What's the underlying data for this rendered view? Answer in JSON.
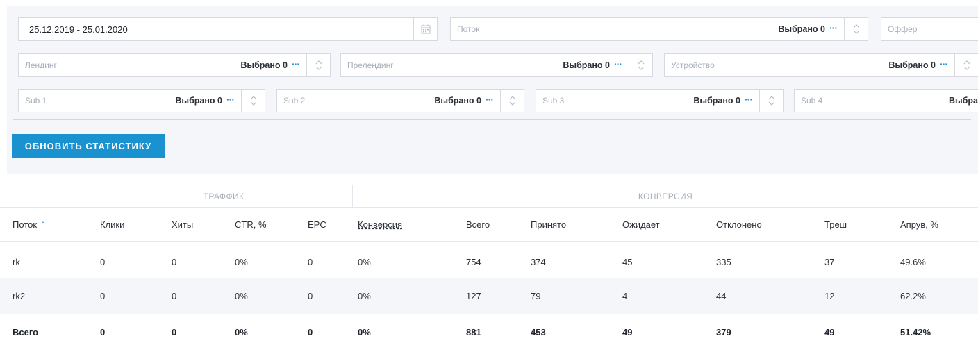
{
  "filters": {
    "date_range": "25.12.2019 - 25.01.2020",
    "selected_label": "Выбрано 0",
    "dots": "···",
    "stream_placeholder": "Поток",
    "offer_placeholder": "Оффер",
    "landing_placeholder": "Лендинг",
    "prelanding_placeholder": "Прелендинг",
    "device_placeholder": "Устройство",
    "sub1_placeholder": "Sub 1",
    "sub2_placeholder": "Sub 2",
    "sub3_placeholder": "Sub 3",
    "sub4_placeholder": "Sub 4",
    "sub4_selected_partial": "Выбра"
  },
  "refresh_button": "ОБНОВИТЬ СТАТИСТИКУ",
  "table": {
    "groups": {
      "traffic": "ТРАФФИК",
      "conversion": "КОНВЕРСИЯ"
    },
    "headers": {
      "stream": "Поток",
      "clicks": "Клики",
      "hits": "Хиты",
      "ctr": "CTR, %",
      "epc": "EPC",
      "conversion": "Конверсия",
      "total": "Всего",
      "accepted": "Принято",
      "pending": "Ожидает",
      "rejected": "Отклонено",
      "trash": "Треш",
      "approve": "Апрув, %"
    },
    "sort_icon": "sort-ascending-icon",
    "rows": [
      {
        "stream": "rk",
        "clicks": "0",
        "hits": "0",
        "ctr": "0%",
        "epc": "0",
        "conversion": "0%",
        "total": "754",
        "accepted": "374",
        "pending": "45",
        "rejected": "335",
        "trash": "37",
        "approve": "49.6%"
      },
      {
        "stream": "rk2",
        "clicks": "0",
        "hits": "0",
        "ctr": "0%",
        "epc": "0",
        "conversion": "0%",
        "total": "127",
        "accepted": "79",
        "pending": "4",
        "rejected": "44",
        "trash": "12",
        "approve": "62.2%"
      }
    ],
    "totals": {
      "stream": "Всего",
      "clicks": "0",
      "hits": "0",
      "ctr": "0%",
      "epc": "0",
      "conversion": "0%",
      "total": "881",
      "accepted": "453",
      "pending": "49",
      "rejected": "379",
      "trash": "49",
      "approve": "51.42%"
    }
  },
  "colors": {
    "accent": "#2690d8",
    "button": "#1a92cf",
    "panel": "#f4f6f9"
  }
}
